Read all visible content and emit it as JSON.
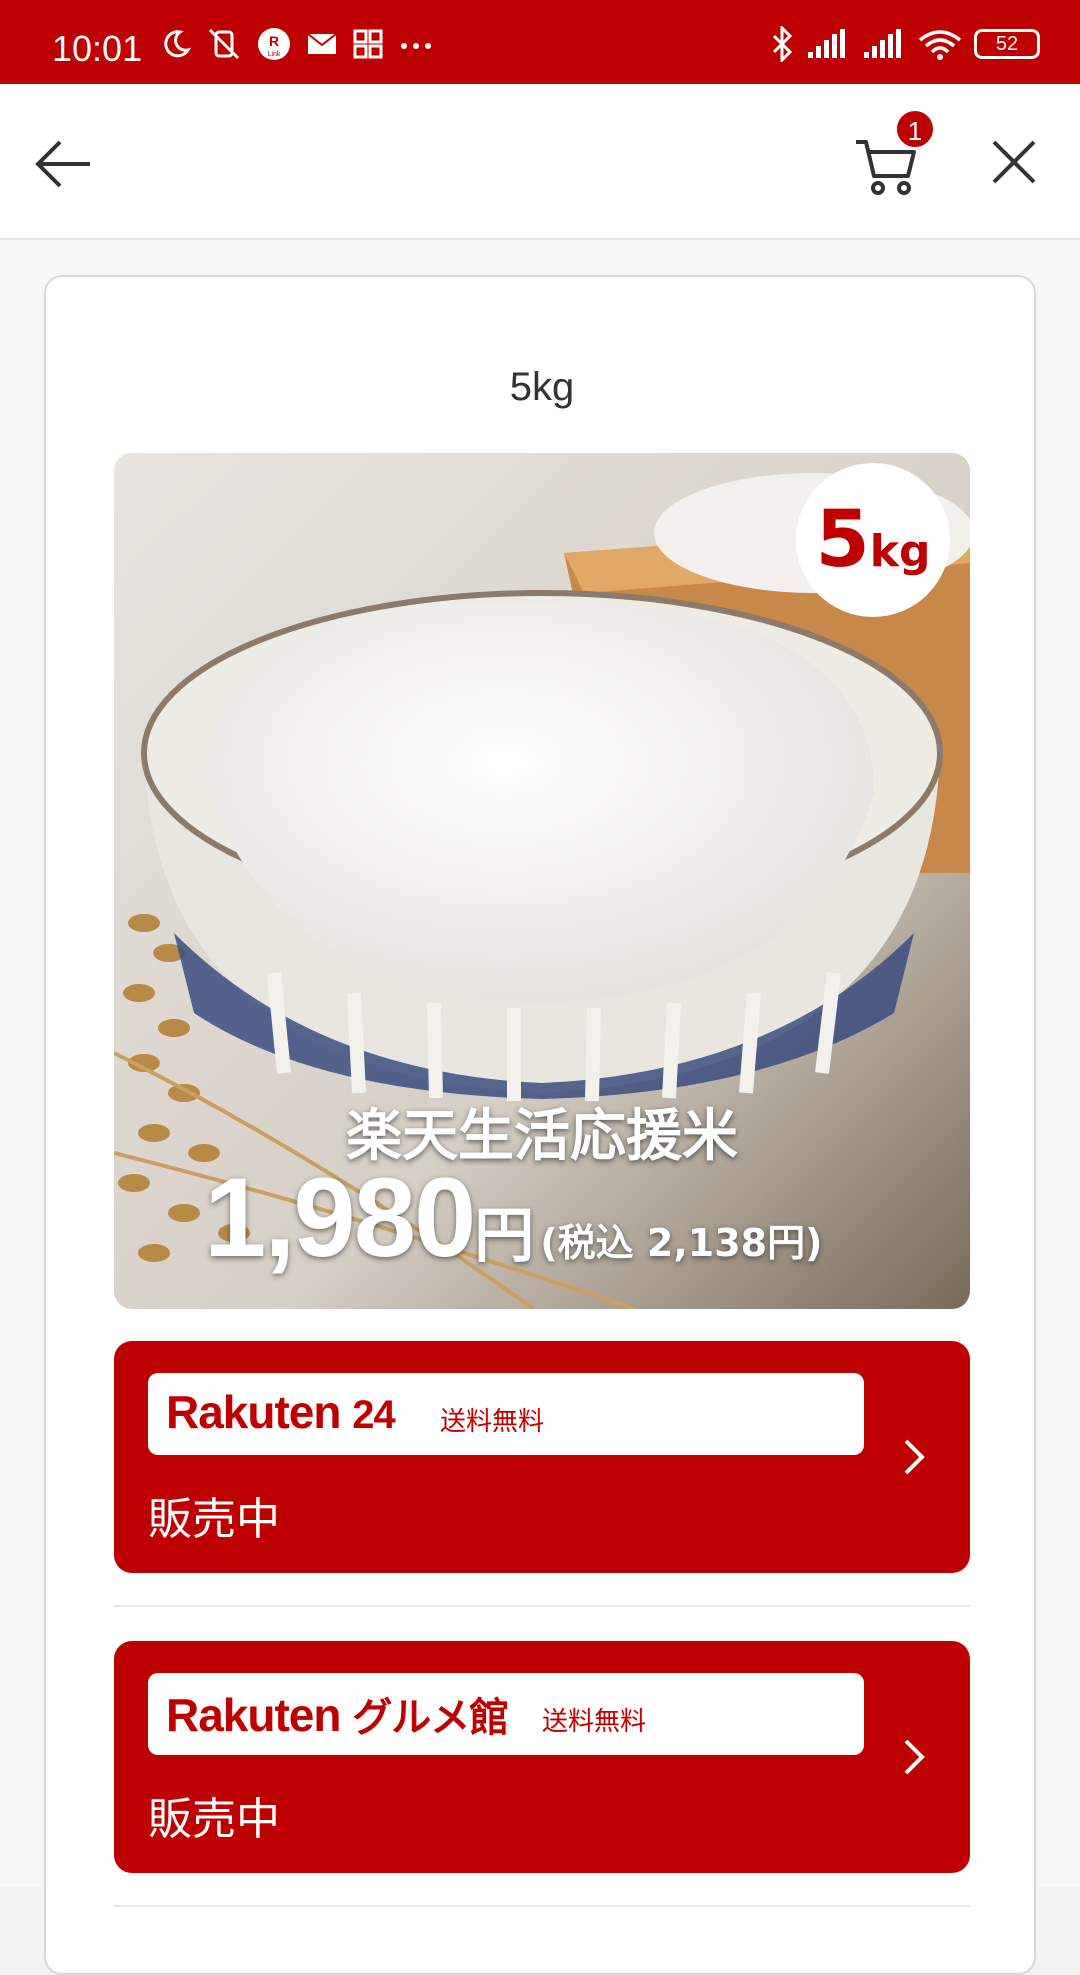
{
  "status_bar": {
    "time": "10:01",
    "left_icons": [
      "moon-icon",
      "vibrate-off-icon",
      "rakuten-link-icon",
      "mail-icon",
      "apps-icon",
      "more-icon"
    ],
    "battery": "52",
    "right_icons": [
      "bluetooth-icon",
      "signal-icon",
      "signal-icon",
      "wifi-icon",
      "battery-icon"
    ]
  },
  "header": {
    "cart_count": "1"
  },
  "product": {
    "size_title": "5kg",
    "badge_number": "5",
    "badge_unit": "kg",
    "name": "楽天生活応援米",
    "price": "1,980",
    "price_yen": "円",
    "price_tax": "(税込 2,138円)"
  },
  "shops": [
    {
      "logo_main": "Rakuten",
      "logo_suffix": "24",
      "shipping": "送料無料",
      "status": "販売中"
    },
    {
      "logo_main": "Rakuten",
      "logo_suffix": "グルメ館",
      "shipping": "送料無料",
      "status": "販売中"
    }
  ],
  "colors": {
    "brand_red": "#bf0000",
    "white": "#ffffff"
  }
}
